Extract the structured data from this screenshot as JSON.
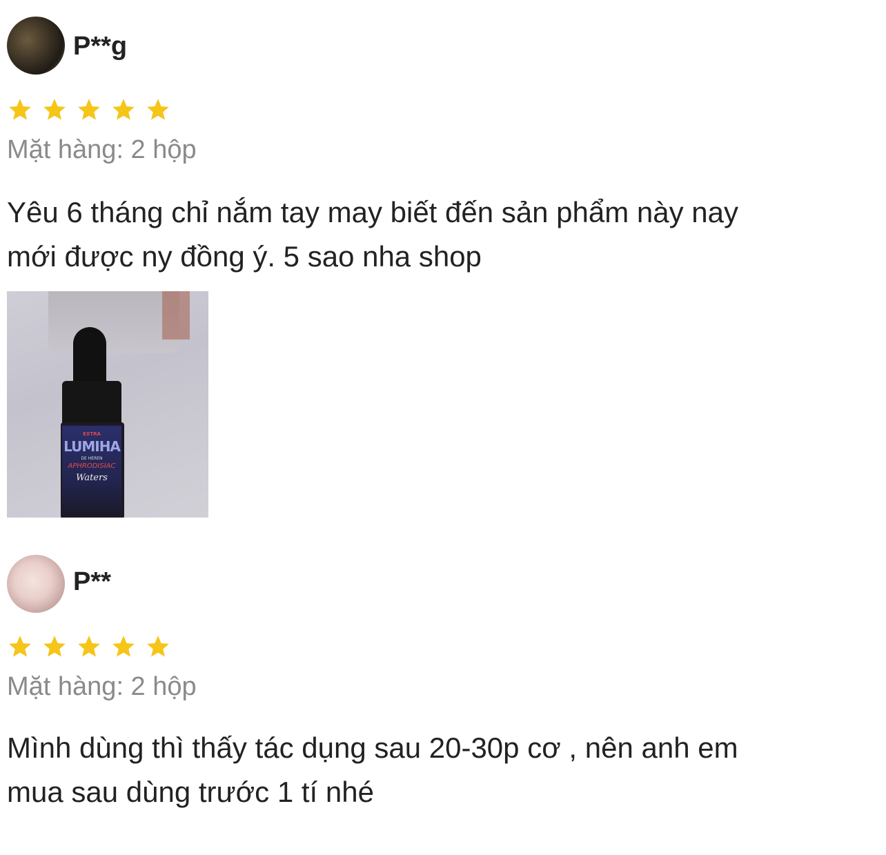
{
  "reviews": [
    {
      "username": "P**g",
      "rating": 5,
      "variation": "Mặt hàng: 2 hộp",
      "comment_lines": [
        "Yêu 6 tháng chỉ nắm tay may biết đến sản phẩm này nay",
        "mới được ny đồng ý. 5 sao nha shop"
      ],
      "photo": {
        "label_extra": "EXTRA",
        "label_brand": "LUMIHA",
        "label_sub": "DE HEREN",
        "label_type": "APHRODISIAC",
        "label_name": "Waters"
      }
    },
    {
      "username": "P**",
      "rating": 5,
      "variation": "Mặt hàng: 2 hộp",
      "comment_lines": [
        "Mình dùng thì thấy tác dụng sau 20-30p cơ , nên anh em",
        "mua sau  dùng trước 1 tí nhé"
      ]
    }
  ],
  "colors": {
    "star": "#f5c518",
    "muted_text": "#8a8a8a",
    "body_text": "#222222"
  }
}
